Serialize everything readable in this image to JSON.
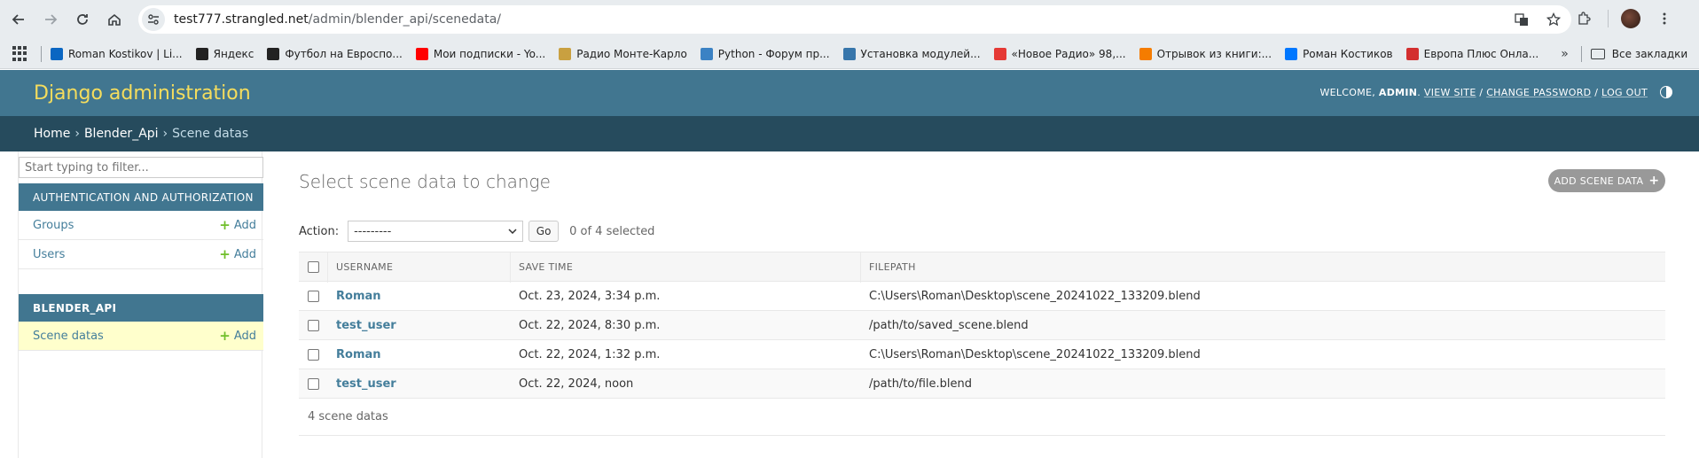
{
  "browser": {
    "url_host": "test777.strangled.net",
    "url_path": "/admin/blender_api/scenedata/",
    "bookmarks": [
      {
        "label": "Roman Kostikov | Li...",
        "color": "#0a66c2"
      },
      {
        "label": "Яндекс",
        "color": "#222222"
      },
      {
        "label": "Футбол на Евроспо...",
        "color": "#222222"
      },
      {
        "label": "Мои подписки - Yo...",
        "color": "#ff0000"
      },
      {
        "label": "Радио Монте-Карло",
        "color": "#c9a040"
      },
      {
        "label": "Python - Форум пр...",
        "color": "#3b82c4"
      },
      {
        "label": "Установка модулей...",
        "color": "#3776ab"
      },
      {
        "label": "«Новое Радио» 98,...",
        "color": "#e53935"
      },
      {
        "label": "Отрывок из книги:...",
        "color": "#f57c00"
      },
      {
        "label": "Роман Костиков",
        "color": "#0077ff"
      },
      {
        "label": "Европа Плюс Онла...",
        "color": "#d32f2f"
      }
    ],
    "more_label": "»",
    "all_bookmarks_label": "Все закладки"
  },
  "header": {
    "brand": "Django administration",
    "welcome": "WELCOME,",
    "username": "ADMIN",
    "view_site": "VIEW SITE",
    "change_password": "CHANGE PASSWORD",
    "log_out": "LOG OUT",
    "sep": "/"
  },
  "breadcrumbs": {
    "home": "Home",
    "app": "Blender_Api",
    "current": "Scene datas",
    "sep": "›"
  },
  "sidebar": {
    "filter_placeholder": "Start typing to filter...",
    "modules": [
      {
        "caption": "AUTHENTICATION AND AUTHORIZATION",
        "models": [
          {
            "name": "Groups",
            "add": "Add"
          },
          {
            "name": "Users",
            "add": "Add"
          }
        ]
      },
      {
        "caption": "BLENDER_API",
        "models": [
          {
            "name": "Scene datas",
            "add": "Add"
          }
        ]
      }
    ],
    "add_plus": "+"
  },
  "content": {
    "title": "Select scene data to change",
    "add_button": "ADD SCENE DATA",
    "add_plus": "+",
    "action_label": "Action:",
    "action_selected": "---------",
    "go_label": "Go",
    "selected_count": "0 of 4 selected",
    "columns": [
      "USERNAME",
      "SAVE TIME",
      "FILEPATH"
    ],
    "rows": [
      {
        "username": "Roman",
        "save_time": "Oct. 23, 2024, 3:34 p.m.",
        "filepath": "C:\\Users\\Roman\\Desktop\\scene_20241022_133209.blend"
      },
      {
        "username": "test_user",
        "save_time": "Oct. 22, 2024, 8:30 p.m.",
        "filepath": "/path/to/saved_scene.blend"
      },
      {
        "username": "Roman",
        "save_time": "Oct. 22, 2024, 1:32 p.m.",
        "filepath": "C:\\Users\\Roman\\Desktop\\scene_20241022_133209.blend"
      },
      {
        "username": "test_user",
        "save_time": "Oct. 22, 2024, noon",
        "filepath": "/path/to/file.blend"
      }
    ],
    "paginator": "4 scene datas"
  }
}
